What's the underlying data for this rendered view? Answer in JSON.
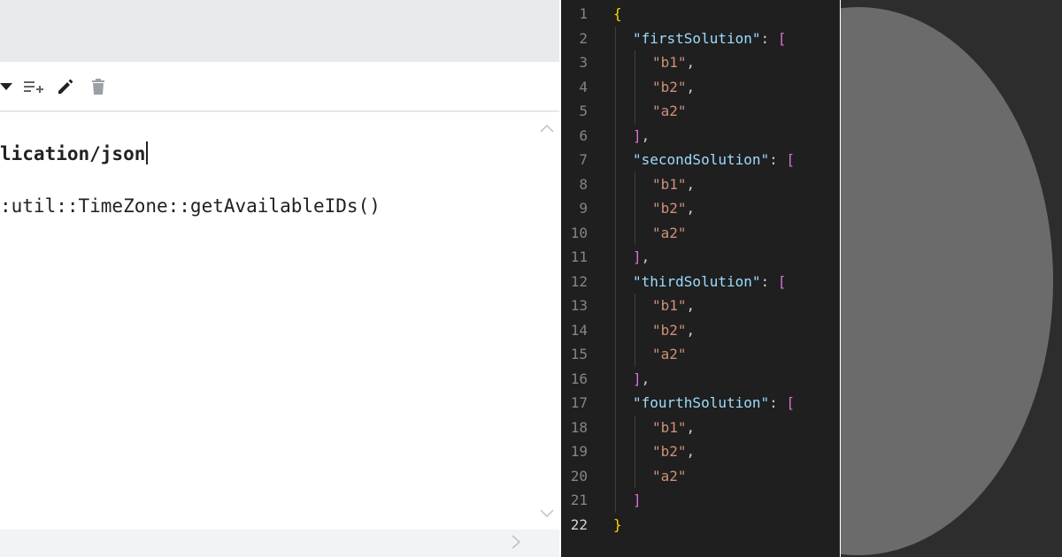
{
  "left_editor": {
    "toolbar": {
      "icons": [
        "caret-down-icon",
        "playlist-add-icon",
        "edit-pencil-icon",
        "trash-icon"
      ]
    },
    "lines": [
      "lication/json",
      ":util::TimeZone::getAvailableIDs()"
    ]
  },
  "code_editor": {
    "active_line": 22,
    "lines": [
      {
        "n": "1",
        "indent": 0,
        "tokens": [
          {
            "t": "{",
            "c": "brace"
          }
        ]
      },
      {
        "n": "2",
        "indent": 1,
        "tokens": [
          {
            "t": "\"firstSolution\"",
            "c": "key"
          },
          {
            "t": ": ",
            "c": "punc"
          },
          {
            "t": "[",
            "c": "bracket"
          }
        ]
      },
      {
        "n": "3",
        "indent": 2,
        "tokens": [
          {
            "t": "\"b1\"",
            "c": "str"
          },
          {
            "t": ",",
            "c": "punc"
          }
        ]
      },
      {
        "n": "4",
        "indent": 2,
        "tokens": [
          {
            "t": "\"b2\"",
            "c": "str"
          },
          {
            "t": ",",
            "c": "punc"
          }
        ]
      },
      {
        "n": "5",
        "indent": 2,
        "tokens": [
          {
            "t": "\"a2\"",
            "c": "str"
          }
        ]
      },
      {
        "n": "6",
        "indent": 1,
        "tokens": [
          {
            "t": "]",
            "c": "bracket"
          },
          {
            "t": ",",
            "c": "punc"
          }
        ]
      },
      {
        "n": "7",
        "indent": 1,
        "tokens": [
          {
            "t": "\"secondSolution\"",
            "c": "key"
          },
          {
            "t": ": ",
            "c": "punc"
          },
          {
            "t": "[",
            "c": "bracket"
          }
        ]
      },
      {
        "n": "8",
        "indent": 2,
        "tokens": [
          {
            "t": "\"b1\"",
            "c": "str"
          },
          {
            "t": ",",
            "c": "punc"
          }
        ]
      },
      {
        "n": "9",
        "indent": 2,
        "tokens": [
          {
            "t": "\"b2\"",
            "c": "str"
          },
          {
            "t": ",",
            "c": "punc"
          }
        ]
      },
      {
        "n": "10",
        "indent": 2,
        "tokens": [
          {
            "t": "\"a2\"",
            "c": "str"
          }
        ]
      },
      {
        "n": "11",
        "indent": 1,
        "tokens": [
          {
            "t": "]",
            "c": "bracket"
          },
          {
            "t": ",",
            "c": "punc"
          }
        ]
      },
      {
        "n": "12",
        "indent": 1,
        "tokens": [
          {
            "t": "\"thirdSolution\"",
            "c": "key"
          },
          {
            "t": ": ",
            "c": "punc"
          },
          {
            "t": "[",
            "c": "bracket"
          }
        ]
      },
      {
        "n": "13",
        "indent": 2,
        "tokens": [
          {
            "t": "\"b1\"",
            "c": "str"
          },
          {
            "t": ",",
            "c": "punc"
          }
        ]
      },
      {
        "n": "14",
        "indent": 2,
        "tokens": [
          {
            "t": "\"b2\"",
            "c": "str"
          },
          {
            "t": ",",
            "c": "punc"
          }
        ]
      },
      {
        "n": "15",
        "indent": 2,
        "tokens": [
          {
            "t": "\"a2\"",
            "c": "str"
          }
        ]
      },
      {
        "n": "16",
        "indent": 1,
        "tokens": [
          {
            "t": "]",
            "c": "bracket"
          },
          {
            "t": ",",
            "c": "punc"
          }
        ]
      },
      {
        "n": "17",
        "indent": 1,
        "tokens": [
          {
            "t": "\"fourthSolution\"",
            "c": "key"
          },
          {
            "t": ": ",
            "c": "punc"
          },
          {
            "t": "[",
            "c": "bracket"
          }
        ]
      },
      {
        "n": "18",
        "indent": 2,
        "tokens": [
          {
            "t": "\"b1\"",
            "c": "str"
          },
          {
            "t": ",",
            "c": "punc"
          }
        ]
      },
      {
        "n": "19",
        "indent": 2,
        "tokens": [
          {
            "t": "\"b2\"",
            "c": "str"
          },
          {
            "t": ",",
            "c": "punc"
          }
        ]
      },
      {
        "n": "20",
        "indent": 2,
        "tokens": [
          {
            "t": "\"a2\"",
            "c": "str"
          }
        ]
      },
      {
        "n": "21",
        "indent": 1,
        "tokens": [
          {
            "t": "]",
            "c": "bracket"
          }
        ]
      },
      {
        "n": "22",
        "indent": 0,
        "tokens": [
          {
            "t": "}",
            "c": "brace"
          }
        ]
      }
    ],
    "colors": {
      "background": "#1f1f1f",
      "brace": "#ffd700",
      "bracket": "#da70d6",
      "key": "#9cdcfe",
      "string": "#ce9178"
    }
  }
}
